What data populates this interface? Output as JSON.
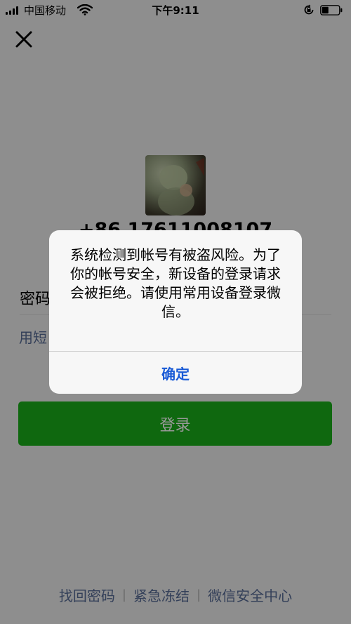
{
  "status_bar": {
    "carrier": "中国移动",
    "time": "下午9:11"
  },
  "account": {
    "phone": "+86 17611008107"
  },
  "form": {
    "password_label": "密码",
    "sms_login_link": "用短"
  },
  "login_button": {
    "label": "登录"
  },
  "footer": {
    "links": [
      "找回密码",
      "紧急冻结",
      "微信安全中心"
    ],
    "separator": "|"
  },
  "dialog": {
    "message": "系统检测到帐号有被盗风险。为了你的帐号安全，新设备的登录请求会被拒绝。请使用常用设备登录微信。",
    "confirm_label": "确定"
  },
  "colors": {
    "primary_green": "#1aad19",
    "link_blue": "#576b95",
    "dialog_button_blue": "#1a5bd6",
    "page_background": "#ededed"
  },
  "icons": [
    "signal-icon",
    "wifi-icon",
    "rotation-lock-icon",
    "battery-icon",
    "close-icon"
  ]
}
